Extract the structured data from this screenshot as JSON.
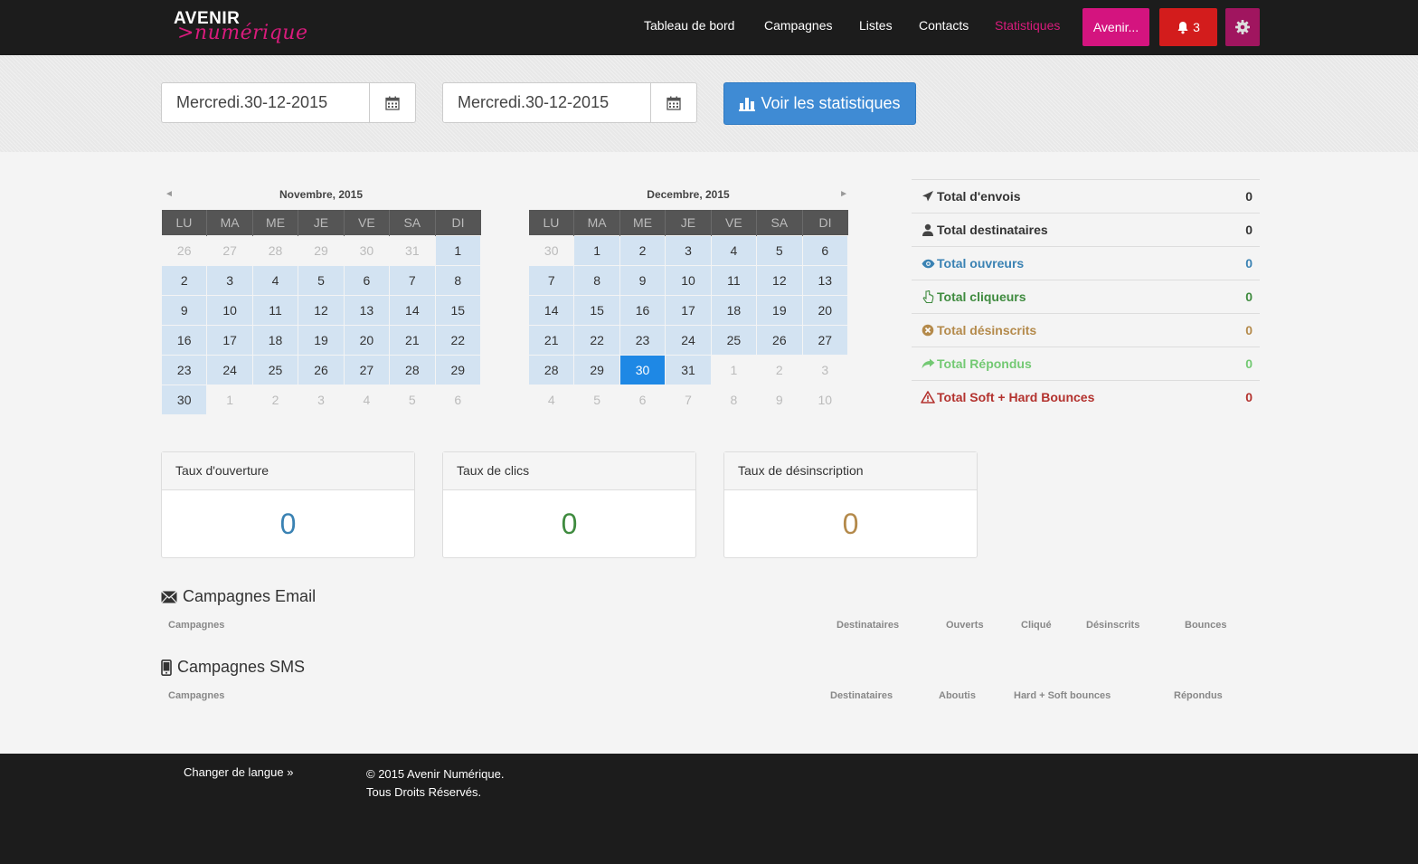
{
  "brand": {
    "name_top": "AVENIR",
    "name_bottom": ">numérique"
  },
  "nav": {
    "links": [
      "Tableau de bord",
      "Campagnes",
      "Listes",
      "Contacts",
      "Statistiques"
    ],
    "account_label": "Avenir...",
    "notif_count": "3"
  },
  "date_range": {
    "start": "Mercredi.30-12-2015",
    "end": "Mercredi.30-12-2015",
    "button_label": "Voir les statistiques"
  },
  "calendars": [
    {
      "title": "Novembre, 2015",
      "prev": "◄",
      "days": [
        "LU",
        "MA",
        "ME",
        "JE",
        "VE",
        "SA",
        "DI"
      ],
      "weeks": [
        [
          [
            "26",
            "o"
          ],
          [
            "27",
            "o"
          ],
          [
            "28",
            "o"
          ],
          [
            "29",
            "o"
          ],
          [
            "30",
            "o"
          ],
          [
            "31",
            "o"
          ],
          [
            "1",
            "r"
          ]
        ],
        [
          [
            "2",
            "r"
          ],
          [
            "3",
            "r"
          ],
          [
            "4",
            "r"
          ],
          [
            "5",
            "r"
          ],
          [
            "6",
            "r"
          ],
          [
            "7",
            "r"
          ],
          [
            "8",
            "r"
          ]
        ],
        [
          [
            "9",
            "r"
          ],
          [
            "10",
            "r"
          ],
          [
            "11",
            "r"
          ],
          [
            "12",
            "r"
          ],
          [
            "13",
            "r"
          ],
          [
            "14",
            "r"
          ],
          [
            "15",
            "r"
          ]
        ],
        [
          [
            "16",
            "r"
          ],
          [
            "17",
            "r"
          ],
          [
            "18",
            "r"
          ],
          [
            "19",
            "r"
          ],
          [
            "20",
            "r"
          ],
          [
            "21",
            "r"
          ],
          [
            "22",
            "r"
          ]
        ],
        [
          [
            "23",
            "r"
          ],
          [
            "24",
            "r"
          ],
          [
            "25",
            "r"
          ],
          [
            "26",
            "r"
          ],
          [
            "27",
            "r"
          ],
          [
            "28",
            "r"
          ],
          [
            "29",
            "r"
          ]
        ],
        [
          [
            "30",
            "r"
          ],
          [
            "1",
            "o"
          ],
          [
            "2",
            "o"
          ],
          [
            "3",
            "o"
          ],
          [
            "4",
            "o"
          ],
          [
            "5",
            "o"
          ],
          [
            "6",
            "o"
          ]
        ]
      ]
    },
    {
      "title": "Decembre, 2015",
      "next": "►",
      "days": [
        "LU",
        "MA",
        "ME",
        "JE",
        "VE",
        "SA",
        "DI"
      ],
      "weeks": [
        [
          [
            "30",
            "o"
          ],
          [
            "1",
            "r"
          ],
          [
            "2",
            "r"
          ],
          [
            "3",
            "r"
          ],
          [
            "4",
            "r"
          ],
          [
            "5",
            "r"
          ],
          [
            "6",
            "r"
          ]
        ],
        [
          [
            "7",
            "r"
          ],
          [
            "8",
            "r"
          ],
          [
            "9",
            "r"
          ],
          [
            "10",
            "r"
          ],
          [
            "11",
            "r"
          ],
          [
            "12",
            "r"
          ],
          [
            "13",
            "r"
          ]
        ],
        [
          [
            "14",
            "r"
          ],
          [
            "15",
            "r"
          ],
          [
            "16",
            "r"
          ],
          [
            "17",
            "r"
          ],
          [
            "18",
            "r"
          ],
          [
            "19",
            "r"
          ],
          [
            "20",
            "r"
          ]
        ],
        [
          [
            "21",
            "r"
          ],
          [
            "22",
            "r"
          ],
          [
            "23",
            "r"
          ],
          [
            "24",
            "r"
          ],
          [
            "25",
            "r"
          ],
          [
            "26",
            "r"
          ],
          [
            "27",
            "r"
          ]
        ],
        [
          [
            "28",
            "r"
          ],
          [
            "29",
            "r"
          ],
          [
            "30",
            "s"
          ],
          [
            "31",
            "r"
          ],
          [
            "1",
            "o"
          ],
          [
            "2",
            "o"
          ],
          [
            "3",
            "o"
          ]
        ],
        [
          [
            "4",
            "o"
          ],
          [
            "5",
            "o"
          ],
          [
            "6",
            "o"
          ],
          [
            "7",
            "o"
          ],
          [
            "8",
            "o"
          ],
          [
            "9",
            "o"
          ],
          [
            "10",
            "o"
          ]
        ]
      ]
    }
  ],
  "totals": [
    {
      "label": "Total d'envois",
      "value": "0",
      "icon": "send-icon",
      "color": "#333333"
    },
    {
      "label": "Total destinataires",
      "value": "0",
      "icon": "user-icon",
      "color": "#333333"
    },
    {
      "label": "Total ouvreurs",
      "value": "0",
      "icon": "eye-icon",
      "color": "#3a82b3"
    },
    {
      "label": "Total cliqueurs",
      "value": "0",
      "icon": "pointer-icon",
      "color": "#3f8b3f"
    },
    {
      "label": "Total désinscrits",
      "value": "0",
      "icon": "remove-circle-icon",
      "color": "#b48a4b"
    },
    {
      "label": "Total Répondus",
      "value": "0",
      "icon": "share-icon",
      "color": "#73c973"
    },
    {
      "label": "Total Soft + Hard Bounces",
      "value": "0",
      "icon": "warning-icon",
      "color": "#b3322e"
    }
  ],
  "rates": [
    {
      "title": "Taux d'ouverture",
      "value": "0",
      "color": "#3a82b3"
    },
    {
      "title": "Taux de clics",
      "value": "0",
      "color": "#3f8b3f"
    },
    {
      "title": "Taux de désinscription",
      "value": "0",
      "color": "#b48a4b"
    }
  ],
  "email_campaigns": {
    "title": "Campagnes Email",
    "columns": [
      "Campagnes",
      "Destinataires",
      "Ouverts",
      "Cliqué",
      "Désinscrits",
      "Bounces"
    ]
  },
  "sms_campaigns": {
    "title": "Campagnes SMS",
    "columns": [
      "Campagnes",
      "Destinataires",
      "Aboutis",
      "Hard + Soft bounces",
      "Répondus"
    ]
  },
  "footer": {
    "lang_label": "Changer de langue »",
    "copyright": "© 2015 Avenir Numérique.",
    "rights": "Tous Droits Réservés."
  }
}
